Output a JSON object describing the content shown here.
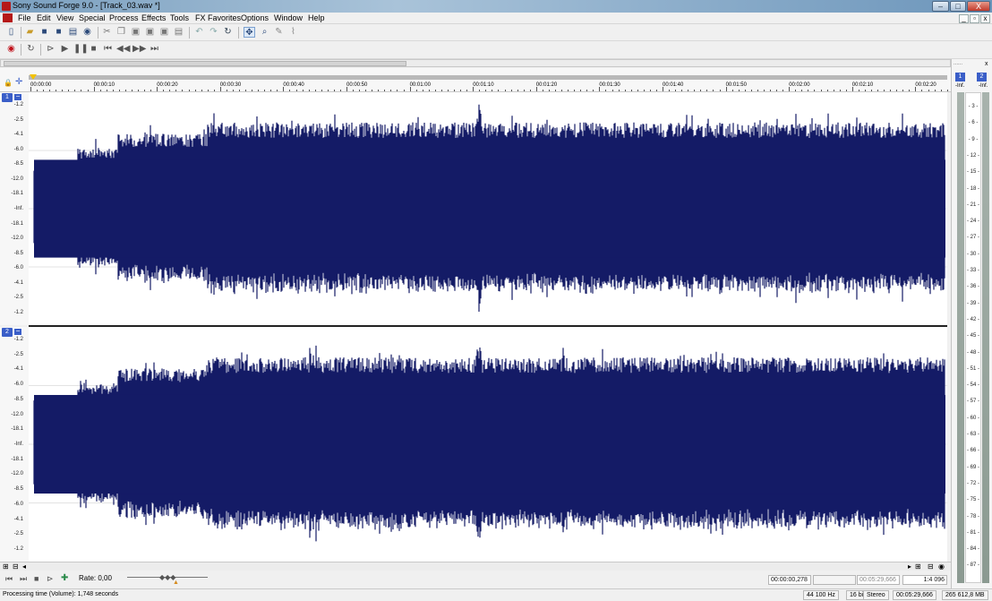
{
  "window": {
    "title": "Sony Sound Forge 9.0 - [Track_03.wav *]",
    "buttons": [
      "–",
      "□",
      "X"
    ]
  },
  "menu": [
    "File",
    "Edit",
    "View",
    "Special",
    "Process",
    "Effects",
    "Tools",
    "FX Favorites",
    "Options",
    "Window",
    "Help"
  ],
  "mdi_buttons": [
    "_",
    "▫",
    "x"
  ],
  "ruler": {
    "labels": [
      "00:00:00",
      "00:00:10",
      "00:00:20",
      "00:00:30",
      "00:00:40",
      "00:00:50",
      "00:01:00",
      "00:01:10",
      "00:01:20",
      "00:01:30",
      "00:01:40",
      "00:01:50",
      "00:02:00",
      "00:02:10",
      "00:02:20"
    ]
  },
  "channels": [
    {
      "number": "1",
      "db_labels": [
        "-1.2",
        "-2.5",
        "-4.1",
        "-6.0",
        "-8.5",
        "-12.0",
        "-18.1",
        "-Inf.",
        "-18.1",
        "-12.0",
        "-8.5",
        "-6.0",
        "-4.1",
        "-2.5",
        "-1.2"
      ]
    },
    {
      "number": "2",
      "db_labels": [
        "-1.2",
        "-2.5",
        "-4.1",
        "-6.0",
        "-8.5",
        "-12.0",
        "-18.1",
        "-Inf.",
        "-18.1",
        "-12.0",
        "-8.5",
        "-6.0",
        "-4.1",
        "-2.5",
        "-1.2"
      ]
    }
  ],
  "transport": {
    "rate_label": "Rate: 0,00",
    "position": "00:00:00,278",
    "length": "00:05:29,666",
    "zoom": "1:4 096"
  },
  "status": {
    "text": "Processing time (Volume): 1,748 seconds",
    "sample_rate": "44 100 Hz",
    "bit_depth": "16 bit",
    "channels": "Stereo",
    "duration": "00:05:29,666",
    "disk_free": "265 612,8 MB"
  },
  "meter": {
    "header": "......",
    "close": "x",
    "channels": [
      "1",
      "2"
    ],
    "inf_labels": [
      "-Inf.",
      "-Inf."
    ],
    "scale": [
      "3",
      "6",
      "9",
      "12",
      "15",
      "18",
      "21",
      "24",
      "27",
      "30",
      "33",
      "36",
      "39",
      "42",
      "45",
      "48",
      "51",
      "54",
      "57",
      "60",
      "63",
      "66",
      "69",
      "72",
      "75",
      "78",
      "81",
      "84",
      "87"
    ]
  },
  "colors": {
    "waveform": "#141b66",
    "channel_badge": "#3a5ec8",
    "record": "#c0101a"
  }
}
